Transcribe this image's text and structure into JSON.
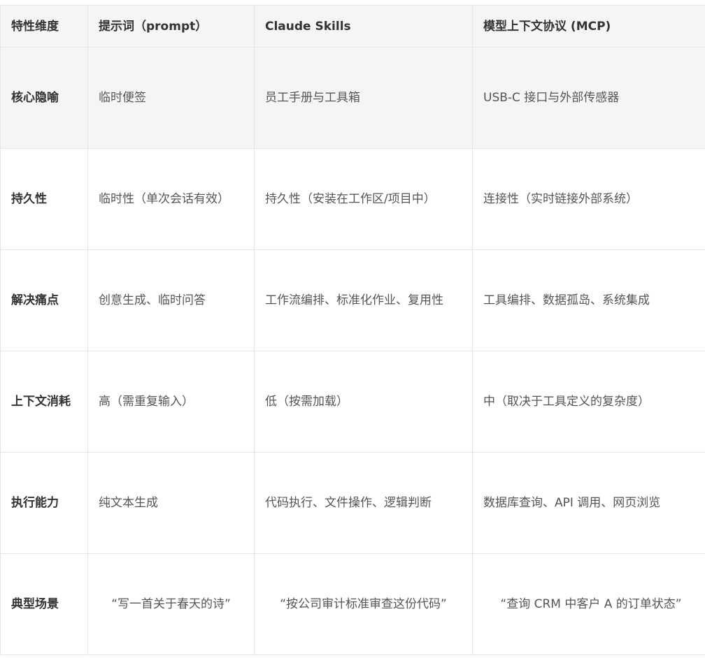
{
  "table": {
    "headers": [
      "特性维度",
      "提示词（prompt）",
      "Claude Skills",
      "模型上下文协议 (MCP)"
    ],
    "rows": [
      [
        "核心隐喻",
        "临时便签",
        "员工手册与工具箱",
        "USB-C 接口与外部传感器"
      ],
      [
        "持久性",
        "临时性（单次会话有效）",
        "持久性（安装在工作区/项目中）",
        "连接性（实时链接外部系统）"
      ],
      [
        "解决痛点",
        "创意生成、临时问答",
        "工作流编排、标准化作业、复用性",
        "工具编排、数据孤岛、系统集成"
      ],
      [
        "上下文消耗",
        "高（需重复输入）",
        "低（按需加载）",
        "中（取决于工具定义的复杂度）"
      ],
      [
        "执行能力",
        "纯文本生成",
        "代码执行、文件操作、逻辑判断",
        "数据库查询、API 调用、网页浏览"
      ],
      [
        "典型场景",
        "“写一首关于春天的诗”",
        "“按公司审计标准审查这份代码”",
        "“查询 CRM 中客户 A 的订单状态”"
      ]
    ]
  },
  "colors": {
    "header_bg": "#f5f5f5",
    "border": "#e5e5e5",
    "text": "#333333",
    "cell_text": "#555555"
  }
}
